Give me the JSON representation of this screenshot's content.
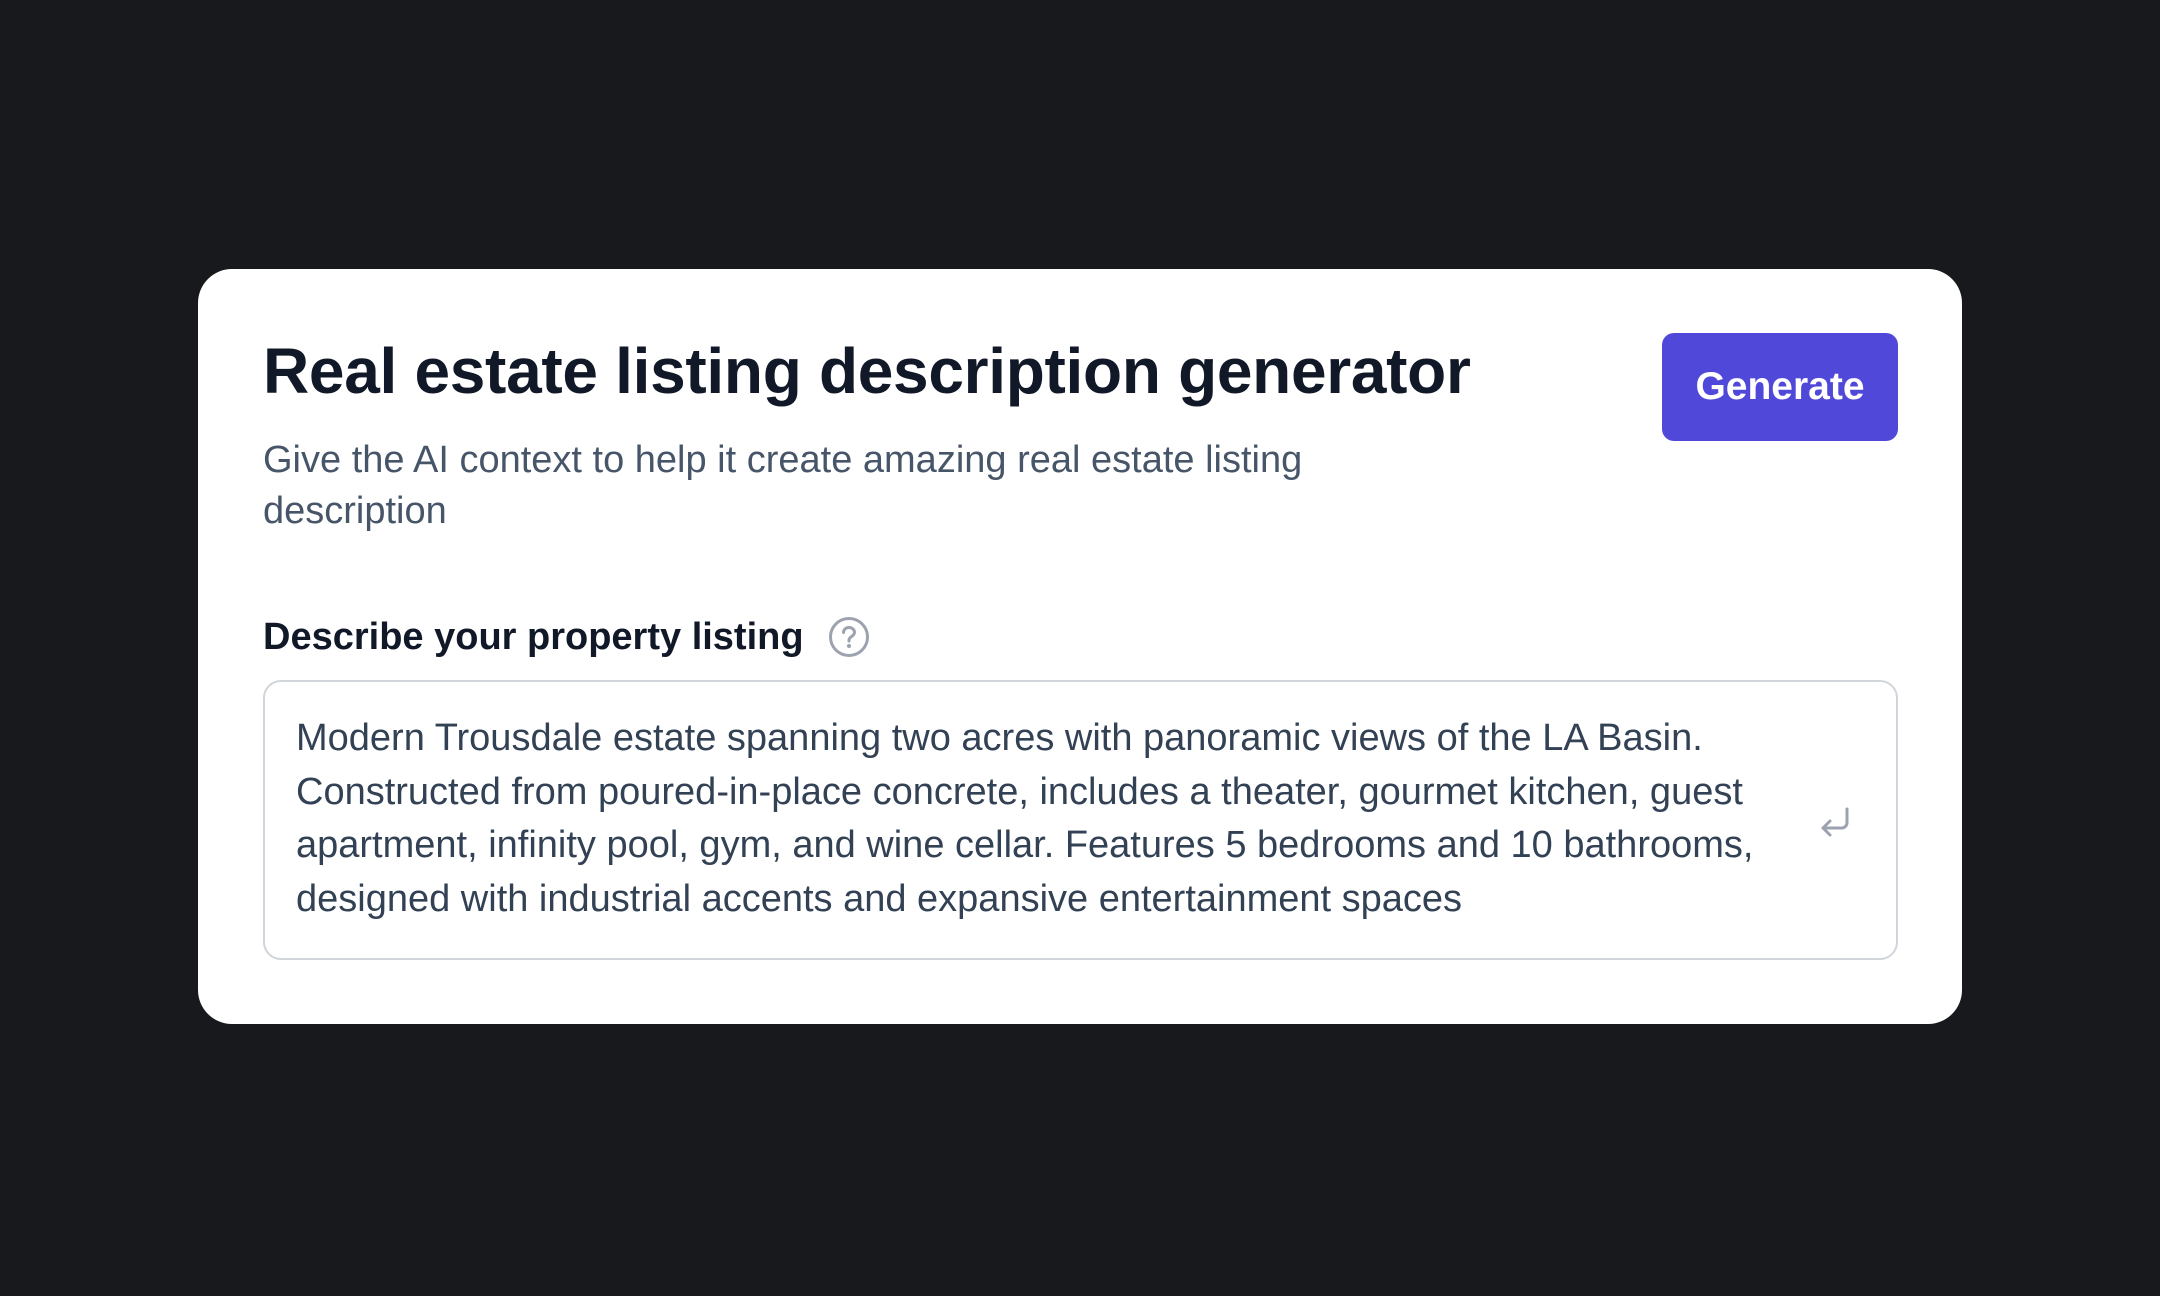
{
  "header": {
    "title": "Real estate listing description generator",
    "subtitle": "Give the AI context to help it create amazing real estate listing description"
  },
  "actions": {
    "generate_label": "Generate"
  },
  "field": {
    "label": "Describe your property listing",
    "help_icon": "question-circle-icon",
    "value": "Modern Trousdale estate spanning two acres with panoramic views of the LA Basin. Constructed from poured-in-place concrete, includes a theater, gourmet kitchen, guest apartment, infinity pool, gym, and wine cellar. Features 5 bedrooms and 10 bathrooms, designed with industrial accents and expansive entertainment spaces",
    "submit_icon": "enter-return-icon"
  },
  "colors": {
    "background": "#18191c",
    "card": "#ffffff",
    "accent": "#5048d8",
    "title_text": "#111827",
    "body_text": "#334155",
    "border": "#d1d5db"
  }
}
